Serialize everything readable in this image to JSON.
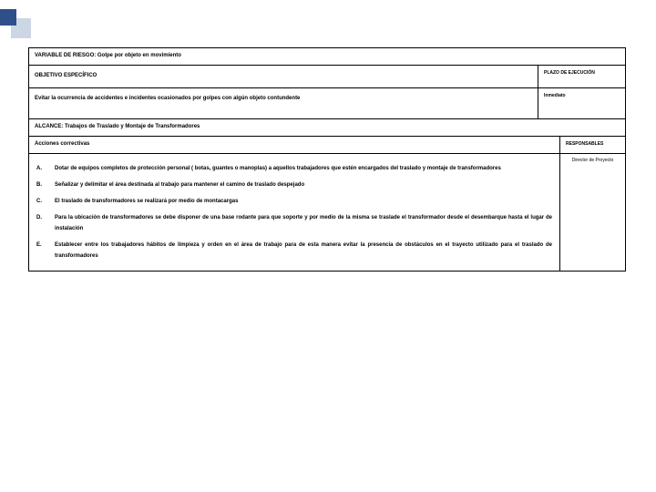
{
  "variable_riesgo": "VARIABLE DE RIESGO:  Golpe por objeto en movimiento",
  "objetivo_label": "OBJETIVO ESPECÍFICO",
  "plazo_label": "PLAZO DE EJECUCIÓN",
  "objetivo_text": "Evitar la ocurrencia de accidentes e incidentes ocasionados por golpes con algún objeto contundente",
  "plazo_value": "Inmediato",
  "alcance": "ALCANCE: Trabajos de Traslado y Montaje de Transformadores",
  "acciones_header": "Acciones correctivas",
  "responsables_label": "RESPONSABLES",
  "responsable_value": "Director de Proyecto",
  "actions": {
    "A": "Dotar de equipos completos de protección personal ( botas, guantes o manoplas) a aquellos trabajadores que estén encargados del traslado y montaje de transformadores",
    "B": "Señalizar y delimitar el área destinada al trabajo para mantener el camino de traslado despejado",
    "C": "El traslado de transformadores se realizará por medio de montacargas",
    "D": "Para la ubicación de transformadores se debe disponer de una base rodante para que soporte y por medio de la misma se traslade el transformador desde el desembarque hasta el lugar de instalación",
    "E": "Establecer entre los trabajadores hábitos de limpieza y orden en el área de trabajo para de esta manera evitar la presencia de obstáculos en el trayecto utilizado para el traslado de transformadores"
  }
}
